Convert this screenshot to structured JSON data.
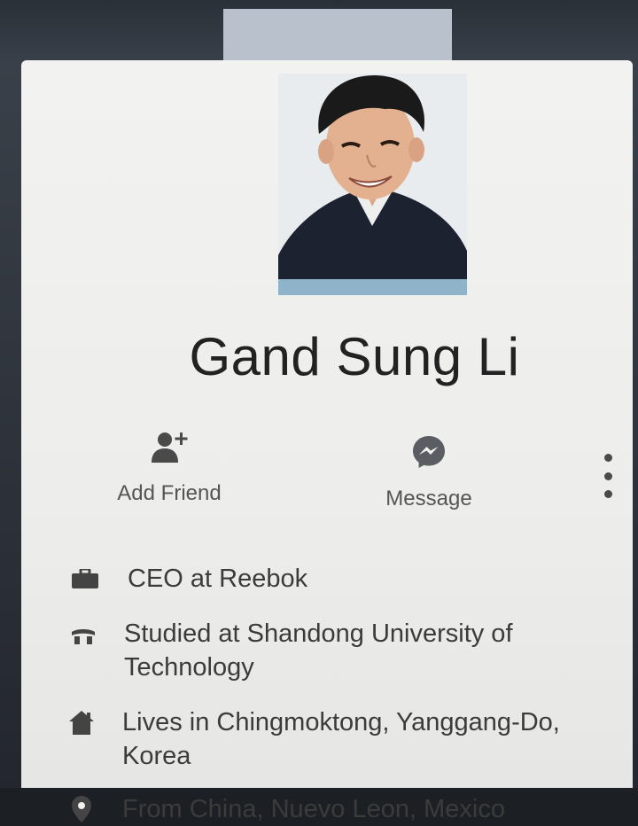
{
  "profile": {
    "name": "Gand Sung Li"
  },
  "actions": {
    "add_friend_label": "Add Friend",
    "message_label": "Message"
  },
  "about": {
    "work": "CEO at Reebok",
    "education": "Studied at Shandong University of Technology",
    "lives": "Lives in Chingmoktong, Yanggang-Do, Korea",
    "from": "From China, Nuevo Leon, Mexico"
  },
  "colors": {
    "card_bg": "#efefed",
    "text": "#222222",
    "icon": "#4a4a4a",
    "messenger_icon": "#5a5e63"
  },
  "icons": [
    "add-friend-icon",
    "messenger-icon",
    "more-options-icon",
    "briefcase-icon",
    "graduation-cap-icon",
    "home-icon",
    "location-pin-icon"
  ]
}
